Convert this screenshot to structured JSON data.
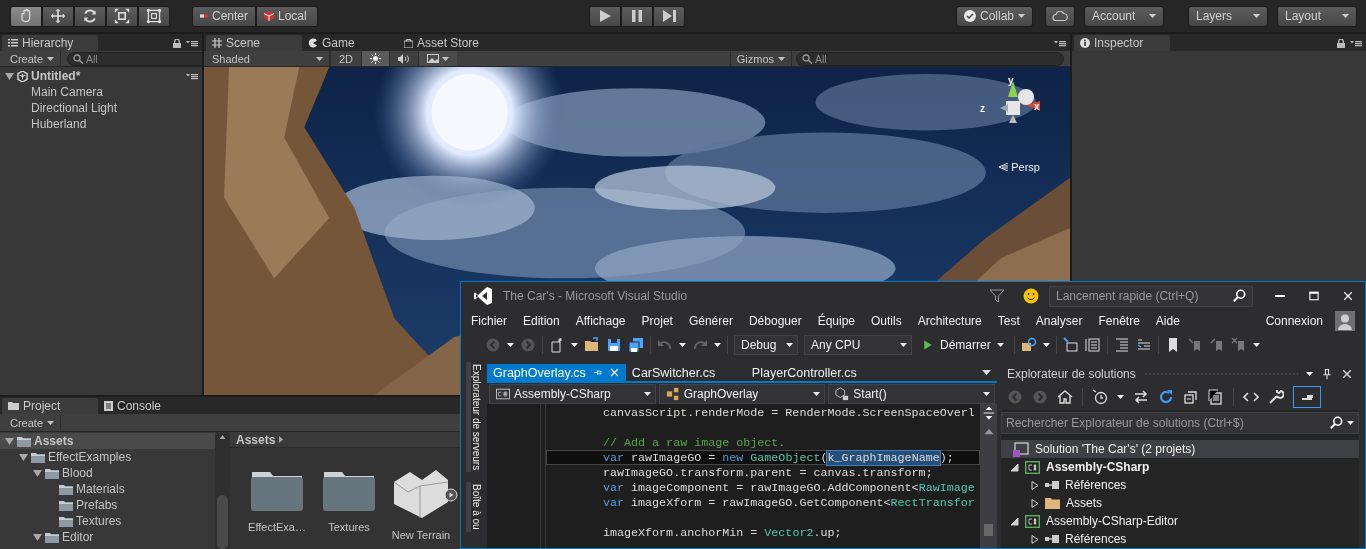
{
  "unity_toolbar": {
    "tools": [
      {
        "selected": true
      },
      {
        "selected": false
      },
      {
        "selected": false
      },
      {
        "selected": false
      },
      {
        "selected": false
      }
    ],
    "pivot_buttons": [
      {
        "label": "Center"
      },
      {
        "label": "Local"
      }
    ],
    "collab": "Collab",
    "account": "Account",
    "layers": "Layers",
    "layout": "Layout"
  },
  "hierarchy": {
    "tab": "Hierarchy",
    "create": "Create",
    "search_placeholder": "All",
    "tree": [
      {
        "name": "Untitled*",
        "kind": "scene",
        "expanded": true,
        "selected": false,
        "children": [
          {
            "name": "Main Camera",
            "selected": false
          },
          {
            "name": "Directional Light",
            "selected": false
          },
          {
            "name": "Huberland",
            "selected": false
          }
        ]
      }
    ]
  },
  "scene_view": {
    "tabs": [
      {
        "label": "Scene",
        "selected": true
      },
      {
        "label": "Game",
        "selected": false
      },
      {
        "label": "Asset Store",
        "selected": false
      }
    ],
    "shading": "Shaded",
    "mode_2d": {
      "label": "2D",
      "on": false
    },
    "lighting_on": true,
    "audio_on": false,
    "gizmos": "Gizmos",
    "search_placeholder": "All",
    "gizmo_axes": [
      "y",
      "z",
      "x"
    ],
    "projection": "Persp"
  },
  "inspector": {
    "tab": "Inspector"
  },
  "project": {
    "tabs": [
      {
        "label": "Project",
        "selected": true
      },
      {
        "label": "Console",
        "selected": false
      }
    ],
    "create": "Create",
    "tree": [
      {
        "name": "Assets",
        "kind": "folder",
        "expanded": true,
        "selected": true,
        "children": [
          {
            "name": "EffectExamples",
            "kind": "folder",
            "expanded": true,
            "selected": false,
            "children": [
              {
                "name": "Blood",
                "kind": "folder",
                "expanded": true,
                "selected": false,
                "children": [
                  {
                    "name": "Materials",
                    "kind": "folder",
                    "selected": false
                  },
                  {
                    "name": "Prefabs",
                    "kind": "folder",
                    "selected": false
                  },
                  {
                    "name": "Textures",
                    "kind": "folder",
                    "selected": false
                  }
                ]
              },
              {
                "name": "Editor",
                "kind": "folder",
                "expanded": true,
                "selected": false
              }
            ]
          }
        ]
      }
    ],
    "breadcrumb": "Assets",
    "items": [
      {
        "name": "EffectExa…",
        "kind": "folder"
      },
      {
        "name": "Textures",
        "kind": "folder"
      },
      {
        "name": "New Terrain",
        "kind": "terrain"
      }
    ]
  },
  "visual_studio": {
    "title": "The Car's - Microsoft Visual Studio",
    "quick_launch_placeholder": "Lancement rapide (Ctrl+Q)",
    "menu": [
      "Fichier",
      "Edition",
      "Affichage",
      "Projet",
      "Générer",
      "Déboguer",
      "Équipe",
      "Outils",
      "Architecture",
      "Test",
      "Analyser",
      "Fenêtre",
      "Aide"
    ],
    "sign_in": "Connexion",
    "configuration": "Debug",
    "platform": "Any CPU",
    "start": "Démarrer",
    "side_tabs": [
      "Explorateur de serveurs",
      "Boîte à ou"
    ],
    "editor": {
      "tabs": [
        {
          "label": "GraphOverlay.cs",
          "selected": true
        },
        {
          "label": "CarSwitcher.cs",
          "selected": false
        },
        {
          "label": "PlayerController.cs",
          "selected": false
        }
      ],
      "nav": [
        "Assembly-CSharp",
        "GraphOverlay",
        "Start()"
      ],
      "lines": [
        {
          "kind": "code",
          "current": false,
          "tokens": [
            {
              "kind": "plain",
              "text": "canvasScript.renderMode = RenderMode.ScreenSpaceOverl"
            }
          ]
        },
        {
          "kind": "blank"
        },
        {
          "kind": "code",
          "current": false,
          "tokens": [
            {
              "kind": "comment",
              "text": "// Add a raw image object."
            }
          ]
        },
        {
          "kind": "code",
          "current": true,
          "tokens": [
            {
              "kind": "keyword",
              "text": "var"
            },
            {
              "kind": "plain",
              "text": " rawImageGO = "
            },
            {
              "kind": "keyword",
              "text": "new"
            },
            {
              "kind": "type",
              "text": " GameObject"
            },
            {
              "kind": "plain",
              "text": "("
            },
            {
              "kind": "selection",
              "text": "k_GraphImageName"
            },
            {
              "kind": "plain",
              "text": ");"
            }
          ]
        },
        {
          "kind": "code",
          "current": false,
          "tokens": [
            {
              "kind": "plain",
              "text": "rawImageGO.transform.parent = canvas.transform;"
            }
          ]
        },
        {
          "kind": "code",
          "current": false,
          "tokens": [
            {
              "kind": "keyword",
              "text": "var"
            },
            {
              "kind": "plain",
              "text": " imageComponent = rawImageGO.AddComponent<"
            },
            {
              "kind": "type",
              "text": "RawImage"
            }
          ]
        },
        {
          "kind": "code",
          "current": false,
          "tokens": [
            {
              "kind": "keyword",
              "text": "var"
            },
            {
              "kind": "plain",
              "text": " imageXform = rawImageGO.GetComponent<"
            },
            {
              "kind": "type",
              "text": "RectTransfor"
            }
          ]
        },
        {
          "kind": "blank"
        },
        {
          "kind": "code",
          "current": false,
          "tokens": [
            {
              "kind": "plain",
              "text": "imageXform.anchorMin = "
            },
            {
              "kind": "type",
              "text": "Vector2"
            },
            {
              "kind": "plain",
              "text": ".up;"
            }
          ]
        }
      ]
    },
    "solution_explorer": {
      "title": "Explorateur de solutions",
      "search_placeholder": "Rechercher Explorateur de solutions (Ctrl+$)",
      "tree": [
        {
          "label": "Solution 'The Car's' (2 projets)",
          "kind": "solution",
          "selected": true,
          "children": [
            {
              "label": "Assembly-CSharp",
              "kind": "project",
              "startup": true,
              "expanded": true,
              "selected": false,
              "children": [
                {
                  "label": "Références",
                  "kind": "references",
                  "expanded": false,
                  "selected": false
                },
                {
                  "label": "Assets",
                  "kind": "folder",
                  "expanded": false,
                  "selected": false
                }
              ]
            },
            {
              "label": "Assembly-CSharp-Editor",
              "kind": "project",
              "startup": false,
              "expanded": true,
              "selected": false,
              "children": [
                {
                  "label": "Références",
                  "kind": "references",
                  "expanded": false,
                  "selected": false
                }
              ]
            }
          ]
        }
      ]
    }
  }
}
